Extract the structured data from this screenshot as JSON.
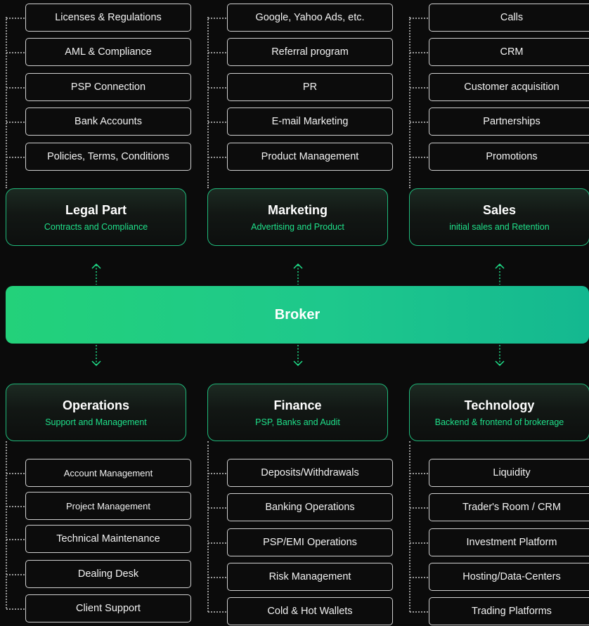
{
  "broker": {
    "label": "Broker"
  },
  "top_groups": [
    {
      "title": "Legal Part",
      "subtitle": "Contracts and Compliance",
      "items": [
        "Licenses & Regulations",
        "AML & Compliance",
        "PSP Connection",
        "Bank Accounts",
        "Policies, Terms, Conditions"
      ]
    },
    {
      "title": "Marketing",
      "subtitle": "Advertising and Product",
      "items": [
        "Google, Yahoo Ads, etc.",
        "Referral program",
        "PR",
        "E-mail Marketing",
        "Product Management"
      ]
    },
    {
      "title": "Sales",
      "subtitle": "initial sales and Retention",
      "items": [
        "Calls",
        "CRM",
        "Customer acquisition",
        "Partnerships",
        "Promotions"
      ]
    }
  ],
  "bottom_groups": [
    {
      "title": "Operations",
      "subtitle": "Support and Management",
      "items": [
        "Account Management",
        "Project Management",
        "Technical Maintenance",
        "Dealing Desk",
        "Client Support"
      ]
    },
    {
      "title": "Finance",
      "subtitle": "PSP, Banks and Audit",
      "items": [
        "Deposits/Withdrawals",
        "Banking Operations",
        "PSP/EMI Operations",
        "Risk Management",
        "Cold & Hot Wallets"
      ]
    },
    {
      "title": "Technology",
      "subtitle": "Backend & frontend of brokerage",
      "items": [
        "Liquidity",
        "Trader's Room / CRM",
        "Investment Platform",
        "Hosting/Data-Centers",
        "Trading Platforms"
      ]
    }
  ],
  "colors": {
    "accent": "#1fe08a",
    "broker_bar": "#1ec88c",
    "background": "#0b0b0b"
  },
  "icons": {
    "up": "arrow-up-icon",
    "down": "arrow-down-icon"
  }
}
